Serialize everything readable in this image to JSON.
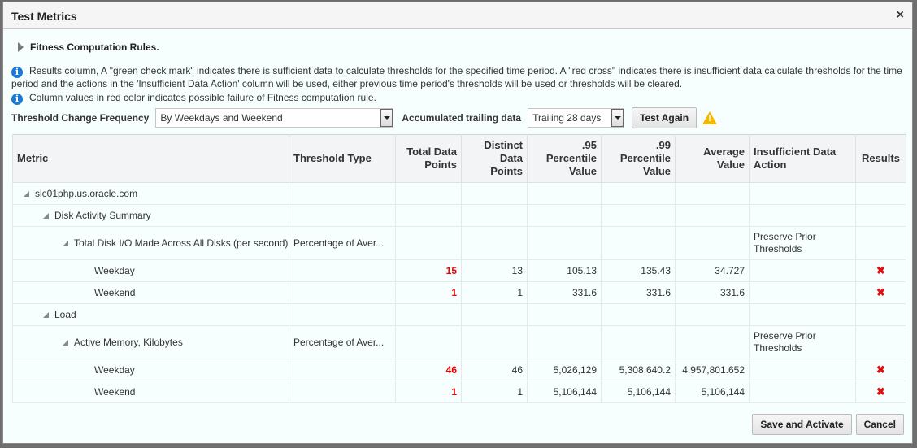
{
  "dialog": {
    "title": "Test Metrics",
    "close_icon": "×"
  },
  "section": {
    "label": "Fitness Computation Rules."
  },
  "info": [
    {
      "icon": "i",
      "text": "Results column, A \"green check mark\" indicates there is sufficient data to calculate thresholds for the specified time period. A \"red cross\" indicates there is insufficient data calculate thresholds for the time period and the actions in the 'Insufficient Data Action' column will be used, either previous time period's thresholds will be used or thresholds will be cleared."
    },
    {
      "icon": "i",
      "text": "Column values in red color indicates possible failure of Fitness computation rule."
    }
  ],
  "controls": {
    "frequency_label": "Threshold Change Frequency",
    "frequency_value": "By Weekdays and Weekend",
    "trailing_label": "Accumulated trailing data",
    "trailing_value": "Trailing 28 days",
    "test_again": "Test Again",
    "warning_icon": "!"
  },
  "table": {
    "headers": {
      "metric": "Metric",
      "threshold_type": "Threshold Type",
      "total": "Total Data Points",
      "distinct": "Distinct Data Points",
      "p95": ".95 Percentile Value",
      "p99": ".99 Percentile Value",
      "avg": "Average Value",
      "action": "Insufficient Data Action",
      "results": "Results"
    },
    "rows": [
      {
        "metric": "slc01php.us.oracle.com",
        "type": "",
        "total": "",
        "distinct": "",
        "p95": "",
        "p99": "",
        "avg": "",
        "action": "",
        "result": ""
      },
      {
        "metric": "Disk Activity Summary",
        "type": "",
        "total": "",
        "distinct": "",
        "p95": "",
        "p99": "",
        "avg": "",
        "action": "",
        "result": ""
      },
      {
        "metric": "Total Disk I/O Made Across All Disks (per second)",
        "type": "Percentage of Aver...",
        "total": "",
        "distinct": "",
        "p95": "",
        "p99": "",
        "avg": "",
        "action": "Preserve Prior Thresholds",
        "result": ""
      },
      {
        "metric": "Weekday",
        "type": "",
        "total": "15",
        "distinct": "13",
        "p95": "105.13",
        "p99": "135.43",
        "avg": "34.727",
        "action": "",
        "result": "✖"
      },
      {
        "metric": "Weekend",
        "type": "",
        "total": "1",
        "distinct": "1",
        "p95": "331.6",
        "p99": "331.6",
        "avg": "331.6",
        "action": "",
        "result": "✖"
      },
      {
        "metric": "Load",
        "type": "",
        "total": "",
        "distinct": "",
        "p95": "",
        "p99": "",
        "avg": "",
        "action": "",
        "result": ""
      },
      {
        "metric": "Active Memory, Kilobytes",
        "type": "Percentage of Aver...",
        "total": "",
        "distinct": "",
        "p95": "",
        "p99": "",
        "avg": "",
        "action": "Preserve Prior Thresholds",
        "result": ""
      },
      {
        "metric": "Weekday",
        "type": "",
        "total": "46",
        "distinct": "46",
        "p95": "5,026,129",
        "p99": "5,308,640.2",
        "avg": "4,957,801.652",
        "action": "",
        "result": "✖"
      },
      {
        "metric": "Weekend",
        "type": "",
        "total": "1",
        "distinct": "1",
        "p95": "5,106,144",
        "p99": "5,106,144",
        "avg": "5,106,144",
        "action": "",
        "result": "✖"
      }
    ]
  },
  "footer": {
    "save": "Save and Activate",
    "cancel": "Cancel"
  },
  "colors": {
    "error": "#dd0000",
    "info": "#1e78d2",
    "warning": "#f5b800"
  }
}
